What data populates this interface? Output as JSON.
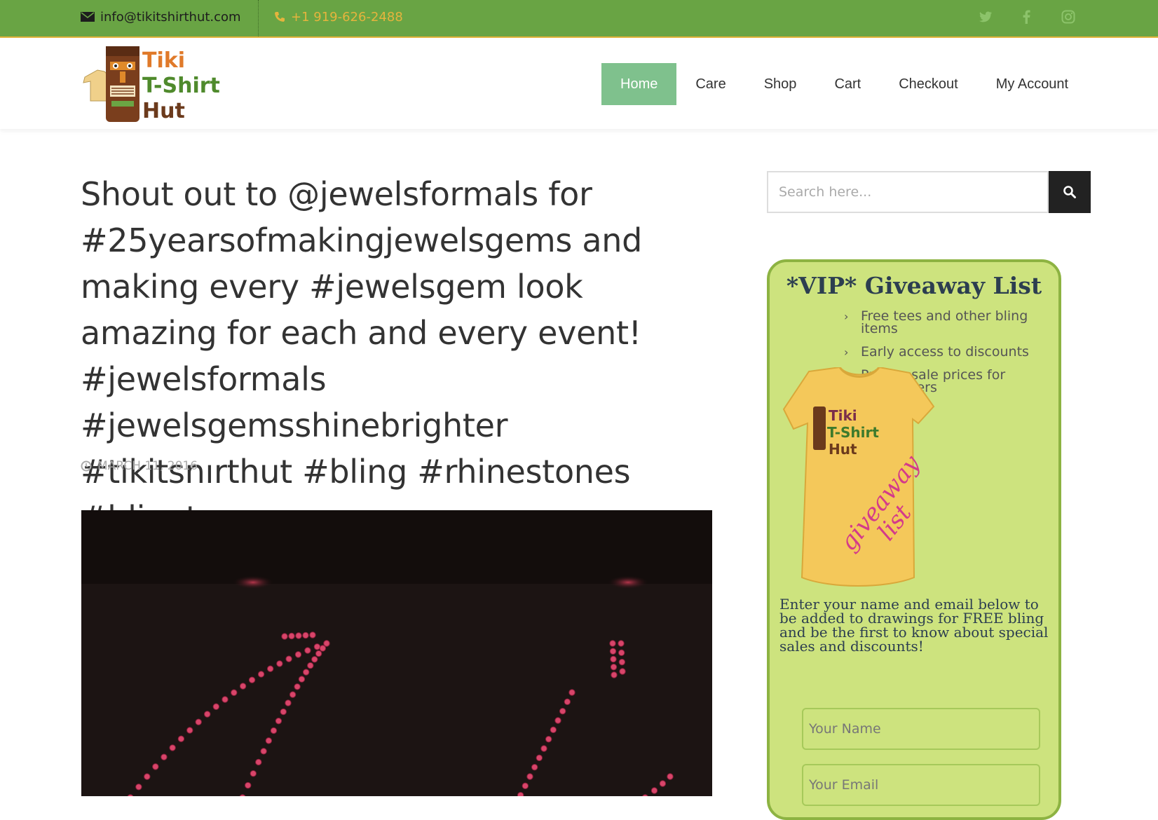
{
  "topbar": {
    "email": "info@tikitshirthut.com",
    "phone": "+1 919-626-2488",
    "social": [
      "twitter-icon",
      "facebook-icon",
      "instagram-icon"
    ]
  },
  "logo": {
    "line1": "Tiki",
    "line2": "T-Shirt",
    "line3": "Hut"
  },
  "nav": {
    "items": [
      {
        "label": "Home",
        "active": true
      },
      {
        "label": "Care"
      },
      {
        "label": "Shop"
      },
      {
        "label": "Cart"
      },
      {
        "label": "Checkout"
      },
      {
        "label": "My Account"
      }
    ]
  },
  "post": {
    "title": "Shout out to @jewelsformals for #25yearsofmakingjewelsgems and making every #jewelsgem look amazing for each and every event! #jewelsformals #jewelsgemsshinebrighter #tikitsnırthut #bling #rhinestones #blingtee",
    "date": "MARCH 11, 2016"
  },
  "sidebar": {
    "search_placeholder": "Search here...",
    "vip": {
      "title": "*VIP* Giveaway List",
      "bullets": [
        "Free tees and other bling items",
        "Early access to discounts",
        "Private sale prices for subscribers"
      ],
      "shirt_text_1": "giveaway",
      "shirt_text_2": "list",
      "description": "Enter your name and email below to be added to drawings for FREE bling and be the first to know about special sales and discounts!",
      "name_placeholder": "Your Name",
      "email_placeholder": "Your Email"
    }
  },
  "colors": {
    "topbar": "#69a444",
    "accent_gold": "#e5b43d",
    "nav_active": "#7fc18d",
    "vip_bg": "#cde37e",
    "vip_border": "#8db342"
  }
}
